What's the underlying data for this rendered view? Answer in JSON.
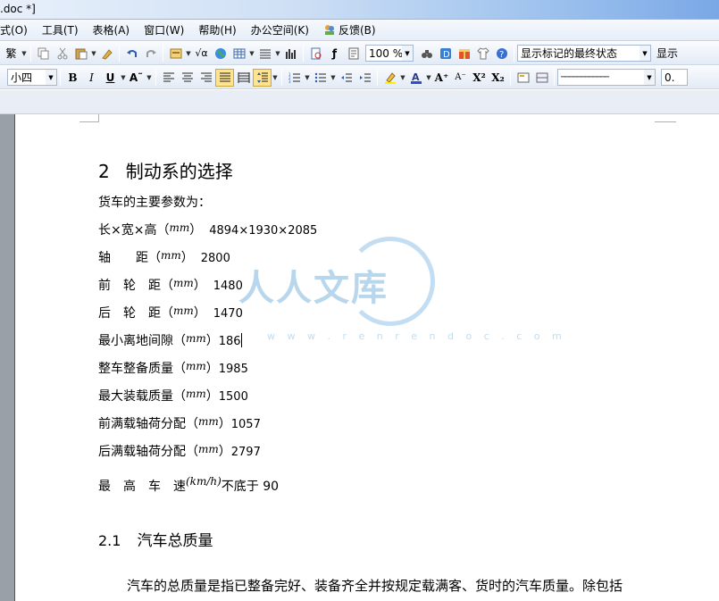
{
  "window": {
    "title": ".doc *]"
  },
  "menu": {
    "items": [
      {
        "label": "式(O)"
      },
      {
        "label": "工具(T)"
      },
      {
        "label": "表格(A)"
      },
      {
        "label": "窗口(W)"
      },
      {
        "label": "帮助(H)"
      },
      {
        "label": "办公空间(K)"
      },
      {
        "label": "反馈(B)"
      }
    ]
  },
  "toolbar1": {
    "traditional_label": "繁",
    "zoom_value": "100 %",
    "markup_view_value": "显示标记的最终状态",
    "show_label": "显示"
  },
  "toolbar2": {
    "font_size_value": "小四",
    "bold_label": "B",
    "italic_label": "I",
    "underline_label": "U",
    "line_style_value": "────────────",
    "line_width_value": "0."
  },
  "document": {
    "heading1": {
      "number": "2",
      "text": "制动系的选择"
    },
    "intro": "货车的主要参数为：",
    "params": [
      {
        "label": "长×宽×高（",
        "unit": "mm",
        "close": "）",
        "value": "4894×1930×2085"
      },
      {
        "label": "轴　　距（",
        "unit": "mm",
        "close": "）",
        "value": "2800"
      },
      {
        "label": "前　轮　距（",
        "unit": "mm",
        "close": "）",
        "value": "1480"
      },
      {
        "label": "后　轮　距（",
        "unit": "mm",
        "close": "）",
        "value": "1470"
      },
      {
        "label": "最小离地间隙（",
        "unit": "mm",
        "close": "）",
        "value": "186"
      },
      {
        "label": "整车整备质量（",
        "unit": "mm",
        "close": "）",
        "value": "1985"
      },
      {
        "label": "最大装载质量（",
        "unit": "mm",
        "close": "）",
        "value": "1500"
      },
      {
        "label": "前满载轴荷分配（",
        "unit": "mm",
        "close": "）",
        "value": "1057"
      },
      {
        "label": "后满载轴荷分配（",
        "unit": "mm",
        "close": "）",
        "value": "2797"
      }
    ],
    "speed": {
      "label": "最　高　车　速",
      "unit": "(km/h)",
      "value": "不底于 90"
    },
    "heading2": {
      "number": "2.1",
      "text": "汽车总质量"
    },
    "paragraph": "汽车的总质量是指已整备完好、装备齐全并按规定载满客、货时的汽车质量。除包括"
  },
  "watermark": {
    "text": "人人文库",
    "url": "w w w . r e n r e n d o c . c o m"
  },
  "colors": {
    "accent_highlight": "#ffe38f",
    "watermark": "#7fb7e0"
  }
}
